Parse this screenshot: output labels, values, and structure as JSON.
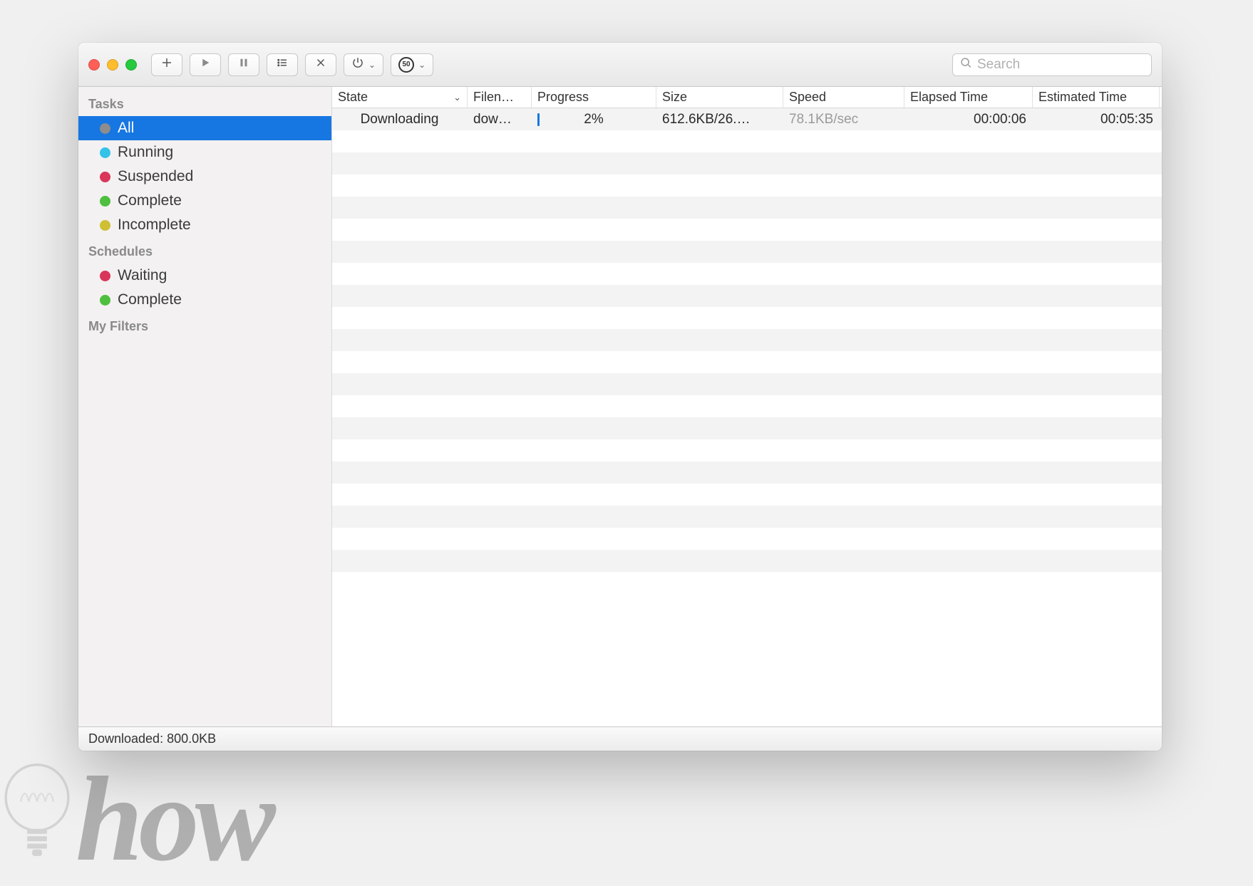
{
  "toolbar": {
    "search_placeholder": "Search",
    "speed_limit_badge": "50"
  },
  "sidebar": {
    "sections": [
      {
        "title": "Tasks",
        "items": [
          {
            "label": "All",
            "color": "#8d8d8d",
            "selected": true
          },
          {
            "label": "Running",
            "color": "#34c3e8",
            "selected": false
          },
          {
            "label": "Suspended",
            "color": "#d9365a",
            "selected": false
          },
          {
            "label": "Complete",
            "color": "#4fbf3f",
            "selected": false
          },
          {
            "label": "Incomplete",
            "color": "#cfbf33",
            "selected": false
          }
        ]
      },
      {
        "title": "Schedules",
        "items": [
          {
            "label": "Waiting",
            "color": "#d9365a",
            "selected": false
          },
          {
            "label": "Complete",
            "color": "#4fbf3f",
            "selected": false
          }
        ]
      },
      {
        "title": "My Filters",
        "items": []
      }
    ]
  },
  "table": {
    "columns": [
      "State",
      "Filen…",
      "Progress",
      "Size",
      "Speed",
      "Elapsed Time",
      "Estimated Time"
    ],
    "sort_column_index": 0,
    "rows": [
      {
        "state": "Downloading",
        "filename": "dow…",
        "progress_label": "2%",
        "progress_pct": 2,
        "size": "612.6KB/26.…",
        "speed": "78.1KB/sec",
        "elapsed": "00:00:06",
        "estimated": "00:05:35"
      }
    ],
    "empty_row_count": 20
  },
  "status": {
    "text": "Downloaded: 800.0KB"
  },
  "watermark": "how"
}
